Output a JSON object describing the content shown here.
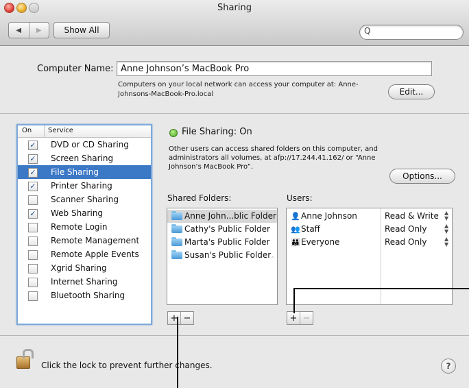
{
  "window": {
    "title": "Sharing"
  },
  "toolbar": {
    "back_glyph": "◀",
    "forward_glyph": "▶",
    "show_all_label": "Show All",
    "search_icon": "Q",
    "search_value": ""
  },
  "computer_name": {
    "label": "Computer Name:",
    "value": "Anne Johnson’s MacBook Pro",
    "description": "Computers on your local network can access your computer at: Anne-Johnsons-MacBook-Pro.local",
    "edit_label": "Edit..."
  },
  "services": {
    "header_on": "On",
    "header_service": "Service",
    "items": [
      {
        "label": "DVD or CD Sharing",
        "checked": "✓"
      },
      {
        "label": "Screen Sharing",
        "checked": "✓"
      },
      {
        "label": "File Sharing",
        "checked": "✓"
      },
      {
        "label": "Printer Sharing",
        "checked": "✓"
      },
      {
        "label": "Scanner Sharing",
        "checked": ""
      },
      {
        "label": "Web Sharing",
        "checked": "✓"
      },
      {
        "label": "Remote Login",
        "checked": ""
      },
      {
        "label": "Remote Management",
        "checked": ""
      },
      {
        "label": "Remote Apple Events",
        "checked": ""
      },
      {
        "label": "Xgrid Sharing",
        "checked": ""
      },
      {
        "label": "Internet Sharing",
        "checked": ""
      },
      {
        "label": "Bluetooth Sharing",
        "checked": ""
      }
    ],
    "selected_index": 2
  },
  "file_sharing": {
    "status": "File Sharing: On",
    "status_color": "#46a81c",
    "description": "Other users can access shared folders on this computer, and administrators all volumes, at afp://17.244.41.162/ or “Anne Johnson’s MacBook Pro”.",
    "options_label": "Options..."
  },
  "shared_folders": {
    "label": "Shared Folders:",
    "items": [
      "Anne John...blic Folder",
      "Cathy's Public Folder",
      "Marta's Public Folder",
      "Susan's Public Folder"
    ],
    "add_label": "+",
    "remove_label": "−"
  },
  "users": {
    "label": "Users:",
    "items": [
      {
        "name": "Anne Johnson",
        "permission": "Read & Write",
        "icon": "person-icon"
      },
      {
        "name": "Staff",
        "permission": "Read Only",
        "icon": "group-icon"
      },
      {
        "name": "Everyone",
        "permission": "Read Only",
        "icon": "everyone-icon"
      }
    ],
    "add_label": "+",
    "remove_label": "−"
  },
  "footer": {
    "lock_text": "Click the lock to prevent further changes.",
    "help_label": "?"
  }
}
